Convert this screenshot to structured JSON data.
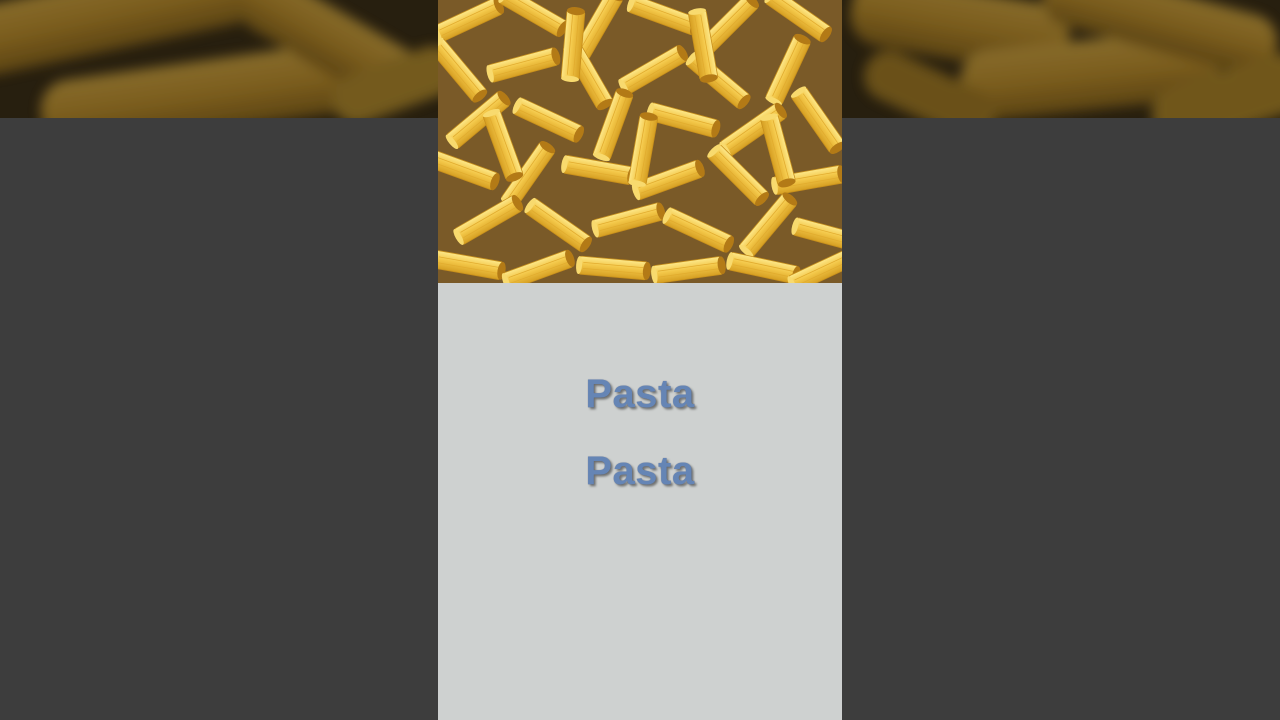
{
  "video": {
    "words": [
      "Pasta",
      "Pasta"
    ],
    "text_color": "#6585b5",
    "panel_color": "#ced1d0",
    "backdrop_color": "#3d3d3d",
    "pasta_color": "#f2c94c"
  }
}
